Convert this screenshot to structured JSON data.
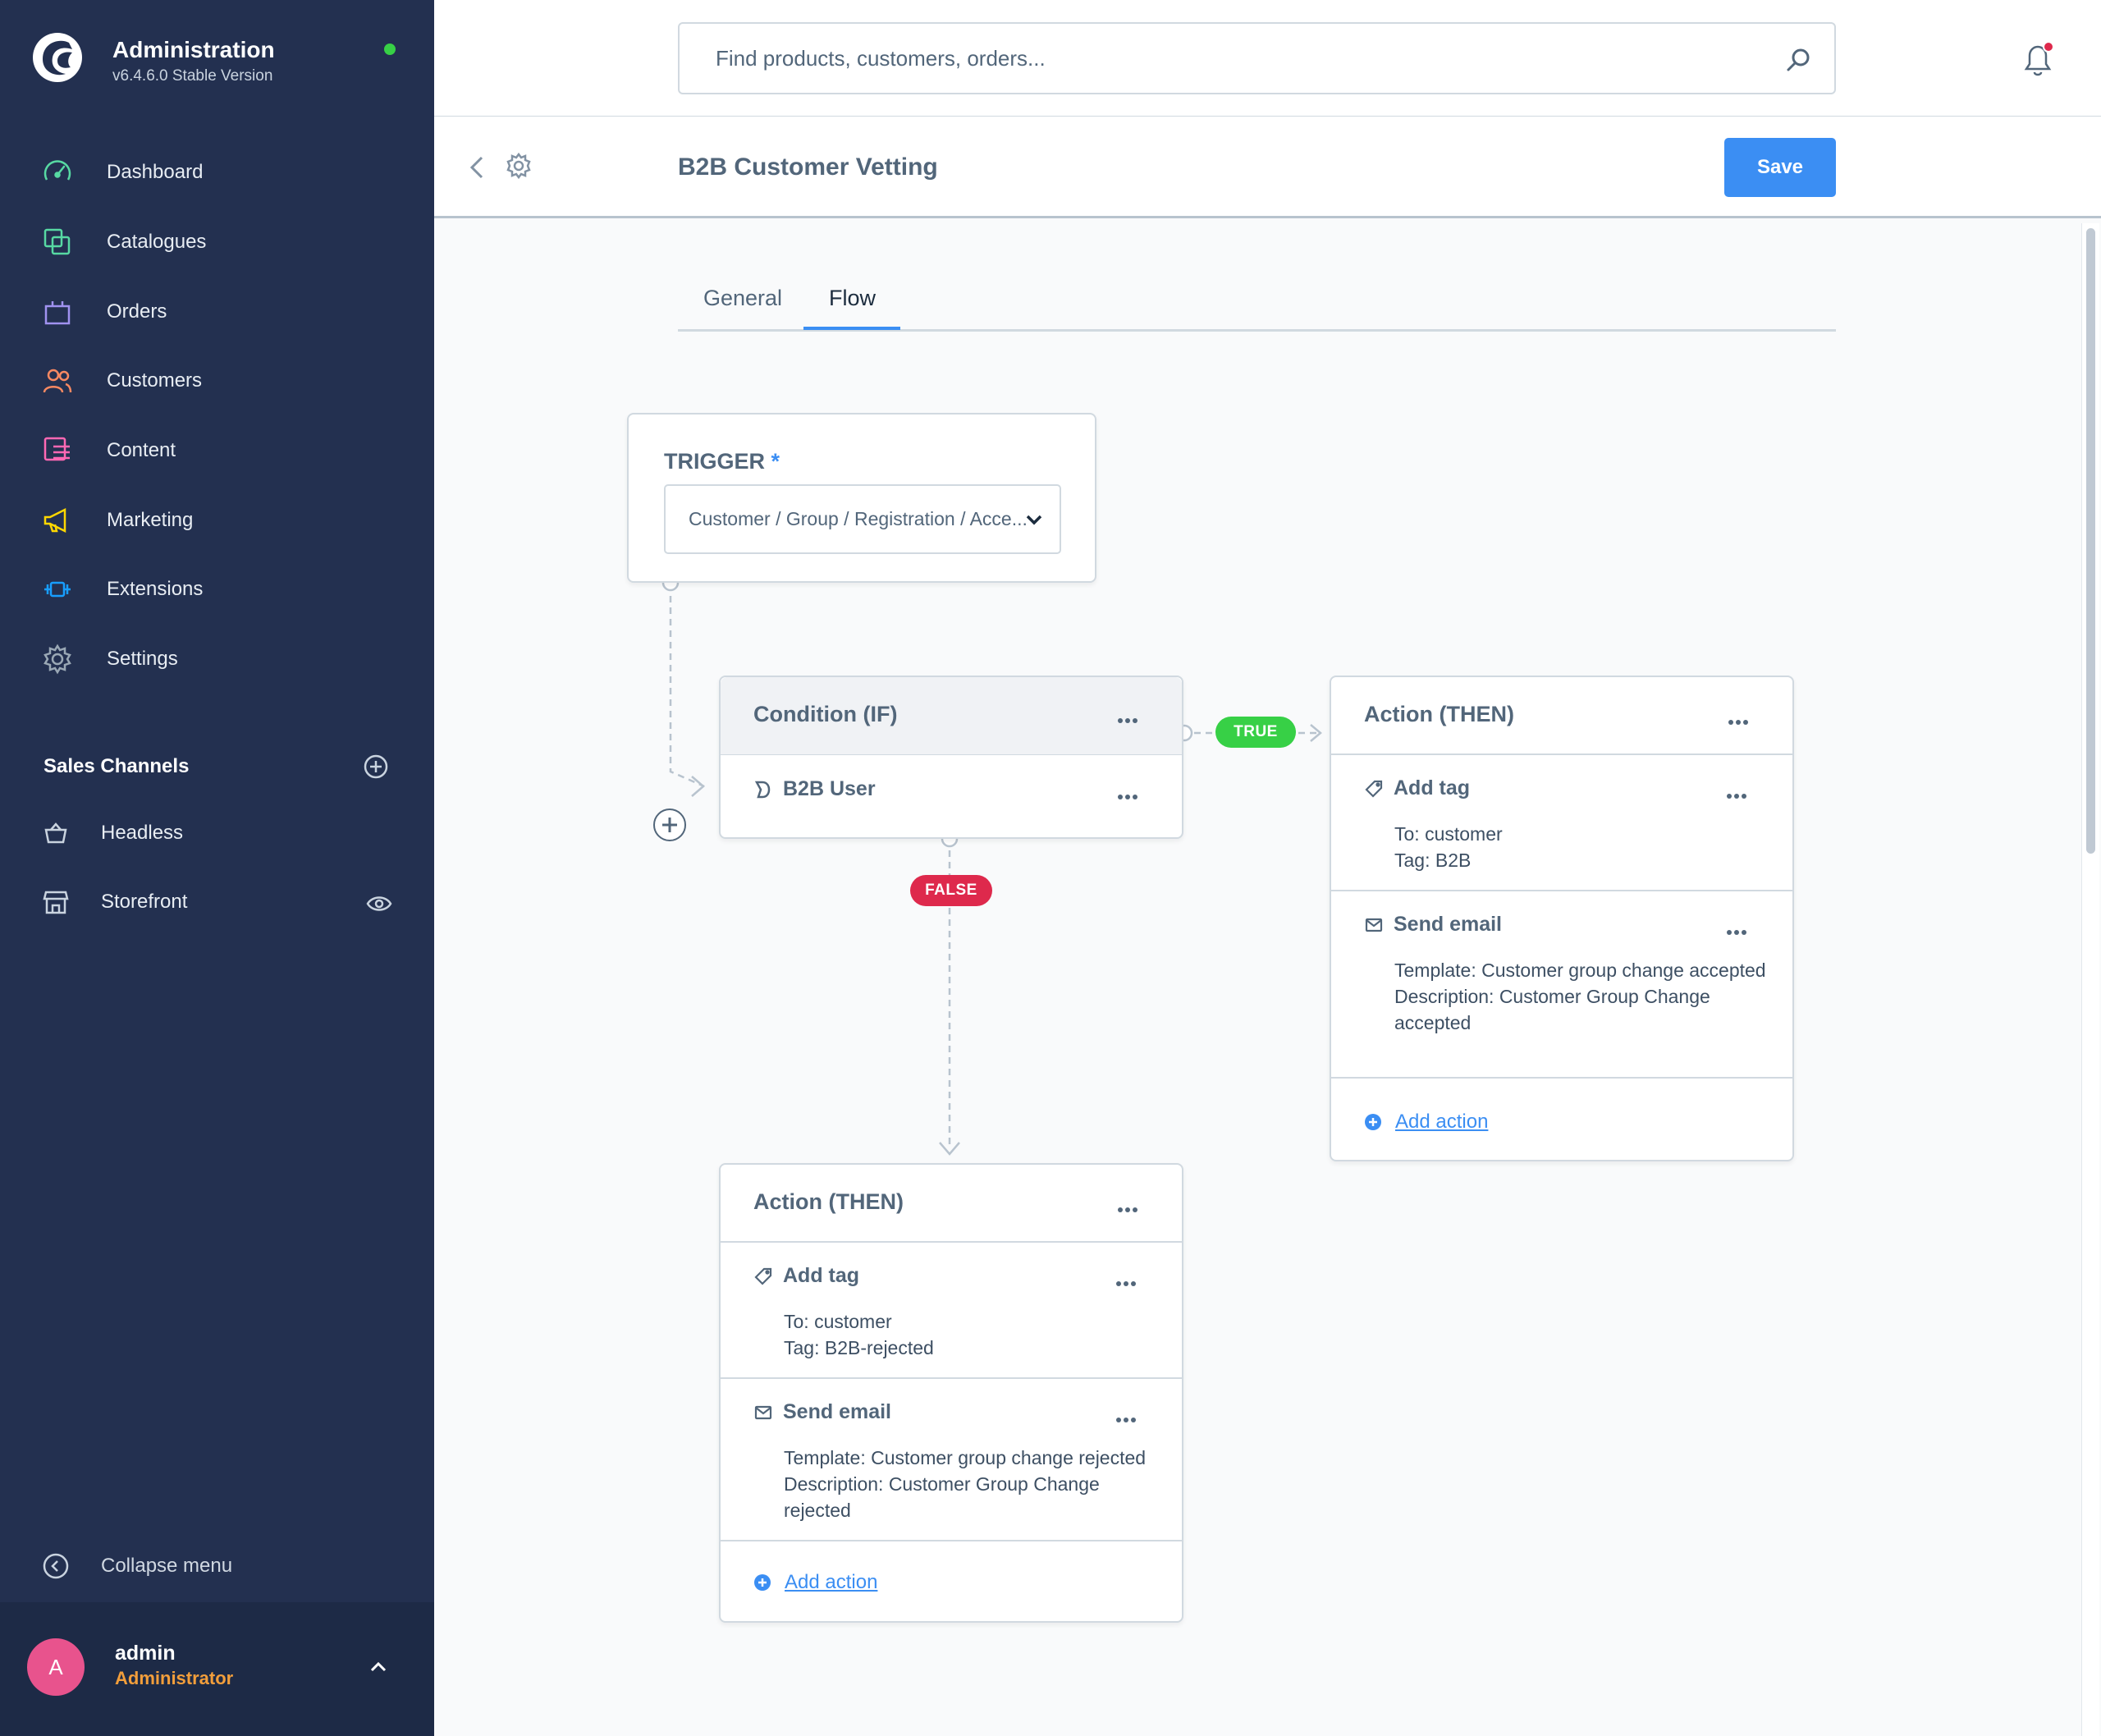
{
  "app": {
    "title": "Administration",
    "version": "v6.4.6.0 Stable Version",
    "status_color": "#37d046"
  },
  "sidebar": {
    "items": [
      {
        "label": "Dashboard",
        "icon": "dashboard-icon",
        "color": "#57d9a3"
      },
      {
        "label": "Catalogues",
        "icon": "catalogues-icon",
        "color": "#57d9a3"
      },
      {
        "label": "Orders",
        "icon": "orders-icon",
        "color": "#a092f0"
      },
      {
        "label": "Customers",
        "icon": "customers-icon",
        "color": "#f88962"
      },
      {
        "label": "Content",
        "icon": "content-icon",
        "color": "#ff68b4"
      },
      {
        "label": "Marketing",
        "icon": "marketing-icon",
        "color": "#ffd700"
      },
      {
        "label": "Extensions",
        "icon": "extensions-icon",
        "color": "#189eff"
      },
      {
        "label": "Settings",
        "icon": "settings-icon",
        "color": "#9aa8b5"
      }
    ],
    "sales_channels": {
      "title": "Sales Channels",
      "items": [
        {
          "label": "Headless",
          "icon": "basket-icon"
        },
        {
          "label": "Storefront",
          "icon": "storefront-icon"
        }
      ]
    },
    "collapse_label": "Collapse menu"
  },
  "user": {
    "initial": "A",
    "name": "admin",
    "role": "Administrator"
  },
  "search": {
    "placeholder": "Find products, customers, orders..."
  },
  "smartbar": {
    "title": "B2B Customer Vetting",
    "save_label": "Save"
  },
  "tabs": [
    {
      "label": "General",
      "active": false
    },
    {
      "label": "Flow",
      "active": true
    }
  ],
  "flow": {
    "trigger": {
      "label": "TRIGGER",
      "required_mark": "*",
      "value": "Customer / Group / Registration / Acce..."
    },
    "condition": {
      "title": "Condition (IF)",
      "rule": "B2B User"
    },
    "true_label": "TRUE",
    "false_label": "FALSE",
    "action_true": {
      "title": "Action (THEN)",
      "actions": [
        {
          "name": "Add tag",
          "icon": "tag-icon",
          "lines": [
            "To: customer",
            "Tag: B2B"
          ]
        },
        {
          "name": "Send email",
          "icon": "mail-icon",
          "lines": [
            "Template: Customer group change accepted",
            "Description: Customer Group Change accepted"
          ]
        }
      ],
      "add_label": "Add action"
    },
    "action_false": {
      "title": "Action (THEN)",
      "actions": [
        {
          "name": "Add tag",
          "icon": "tag-icon",
          "lines": [
            "To: customer",
            "Tag: B2B-rejected"
          ]
        },
        {
          "name": "Send email",
          "icon": "mail-icon",
          "lines": [
            "Template: Customer group change rejected",
            "Description: Customer Group Change rejected"
          ]
        }
      ],
      "add_label": "Add action"
    }
  }
}
